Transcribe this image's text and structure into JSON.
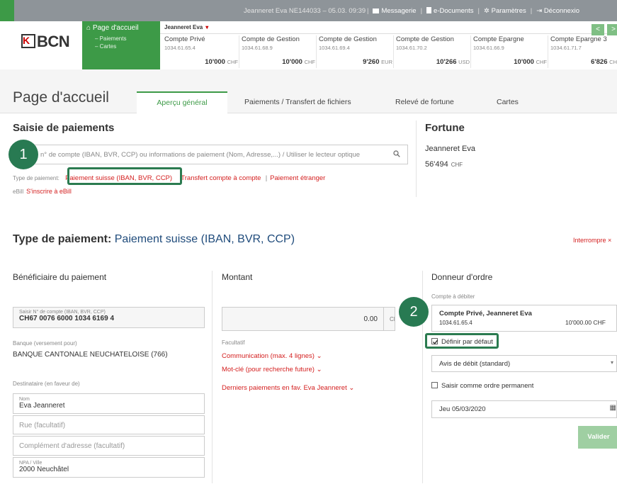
{
  "topbar": {
    "user_info": "Jeanneret Eva   NE144033 – 05.03. 09:39",
    "messagerie": "Messagerie",
    "edocuments": "e-Documents",
    "parametres": "Paramètres",
    "deconnexion": "Déconnexio",
    "separator": "|"
  },
  "logo": {
    "text": "BCN",
    "mark": "K"
  },
  "green_menu": {
    "home": "Page d'accueil",
    "items": [
      "– Paiements",
      "– Cartes"
    ]
  },
  "accounts_owner": "Jeanneret Eva",
  "accounts": [
    {
      "name": "Compte Privé",
      "number": "1034.61.65.4",
      "balance": "10'000",
      "currency": "CHF"
    },
    {
      "name": "Compte de Gestion",
      "number": "1034.61.68.9",
      "balance": "10'000",
      "currency": "CHF"
    },
    {
      "name": "Compte de Gestion",
      "number": "1034.61.69.4",
      "balance": "9'260",
      "currency": "EUR"
    },
    {
      "name": "Compte de Gestion",
      "number": "1034.61.70.2",
      "balance": "10'266",
      "currency": "USD"
    },
    {
      "name": "Compte Epargne",
      "number": "1034.61.66.9",
      "balance": "10'000",
      "currency": "CHF"
    },
    {
      "name": "Compte Epargne 3",
      "number": "1034.61.71.7",
      "balance": "6'826",
      "currency": "CH"
    }
  ],
  "nav": {
    "prev": "<",
    "next": ">"
  },
  "page_title": "Page d'accueil",
  "tabs": [
    "Aperçu général",
    "Paiements / Transfert de fichiers",
    "Relevé de fortune",
    "Cartes"
  ],
  "saisie": {
    "title": "Saisie de paiements",
    "search_placeholder": "n° de compte (IBAN, BVR, CCP) ou informations de paiement (Nom, Adresse,...) / Utiliser le lecteur optique",
    "type_label": "Type de paiement:",
    "type_options": [
      "Paiement suisse (IBAN, BVR, CCP)",
      "Transfert compte à compte",
      "Paiement étranger"
    ],
    "ebill_label": "eBill",
    "ebill_link": "S'inscrire à eBill"
  },
  "fortune": {
    "title": "Fortune",
    "name": "Jeanneret Eva",
    "value": "56'494",
    "currency": "CHF"
  },
  "callouts": [
    "1",
    "2"
  ],
  "payment": {
    "title_prefix": "Type de paiement:",
    "title_value": "Paiement suisse (IBAN, BVR, CCP)",
    "cancel": "Interrompre",
    "cancel_icon": "×"
  },
  "beneficiary": {
    "heading": "Bénéficiaire du paiement",
    "account_label": "Saisir N° de compte (IBAN, BVR, CCP)",
    "account_value": "CH67 0076 6000 1034 6169 4",
    "bank_label": "Banque (versement pour)",
    "bank_value": "BANQUE CANTONALE NEUCHATELOISE (766)",
    "dest_label": "Destinataire (en faveur de)",
    "name_label": "Nom",
    "name_value": "Eva Jeanneret",
    "street_placeholder": "Rue (facultatif)",
    "complement_placeholder": "Complément d'adresse (facultatif)",
    "city_label": "NPA / Ville",
    "city_value": "2000 Neuchâtel"
  },
  "amount": {
    "heading": "Montant",
    "value": "0.00",
    "currency": "CH",
    "optional_label": "Facultatif",
    "links": [
      "Communication (max. 4 lignes)",
      "Mot-clé (pour recherche future)",
      "Derniers paiements en fav. Eva Jeanneret"
    ]
  },
  "orderer": {
    "heading": "Donneur d'ordre",
    "debit_label": "Compte à débiter",
    "account_name": "Compte Privé, Jeanneret Eva",
    "account_number": "1034.61.65.4",
    "account_balance": "10'000.00 CHF",
    "default_label": "Définir par défaut",
    "notice_value": "Avis de débit (standard)",
    "standing_label": "Saisir comme ordre permanent",
    "date_value": "Jeu   05/03/2020",
    "validate": "Valider"
  },
  "colors": {
    "brand_green": "#3d9a47",
    "callout_green": "#287a52",
    "link_red": "#d42020",
    "title_blue": "#1f4b7b"
  }
}
